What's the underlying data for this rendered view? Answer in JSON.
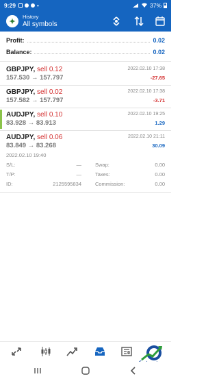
{
  "status_bar": {
    "time": "9:29",
    "battery": "37%"
  },
  "app_bar": {
    "subtitle": "History",
    "title": "All symbols"
  },
  "summary": {
    "profit_label": "Profit:",
    "profit_value": "0.02",
    "balance_label": "Balance:",
    "balance_value": "0.02"
  },
  "trades": [
    {
      "symbol": "GBPJPY,",
      "side": "sell 0.12",
      "prices": "157.530 → 157.797",
      "date": "2022.02.10 17:38",
      "profit": "-27.65",
      "profit_sign": "neg",
      "selected": false
    },
    {
      "symbol": "GBPJPY,",
      "side": "sell 0.02",
      "prices": "157.582 → 157.797",
      "date": "2022.02.10 17:38",
      "profit": "-3.71",
      "profit_sign": "neg",
      "selected": false
    },
    {
      "symbol": "AUDJPY,",
      "side": "sell 0.10",
      "prices": "83.928 → 83.913",
      "date": "2022.02.10 19:25",
      "profit": "1.29",
      "profit_sign": "pos",
      "selected": true
    },
    {
      "symbol": "AUDJPY,",
      "side": "sell 0.06",
      "prices": "83.849 → 83.268",
      "date": "2022.02.10 21:11",
      "profit": "30.09",
      "profit_sign": "pos",
      "selected": false
    }
  ],
  "details": {
    "open_time": "2022.02.10 19:40",
    "sl_label": "S/L:",
    "sl_value": "—",
    "swap_label": "Swap:",
    "swap_value": "0.00",
    "tp_label": "T/P:",
    "tp_value": "—",
    "taxes_label": "Taxes:",
    "taxes_value": "0.00",
    "id_label": "ID:",
    "id_value": "2125595834",
    "commission_label": "Commission:",
    "commission_value": "0.00"
  },
  "bottom_nav": {
    "items": [
      "quotes-icon",
      "chart-icon",
      "trade-icon",
      "history-icon",
      "news-icon"
    ],
    "active": "history-icon",
    "accent": "#1565c0"
  },
  "watermark": {
    "text": "عرب فوركس"
  }
}
